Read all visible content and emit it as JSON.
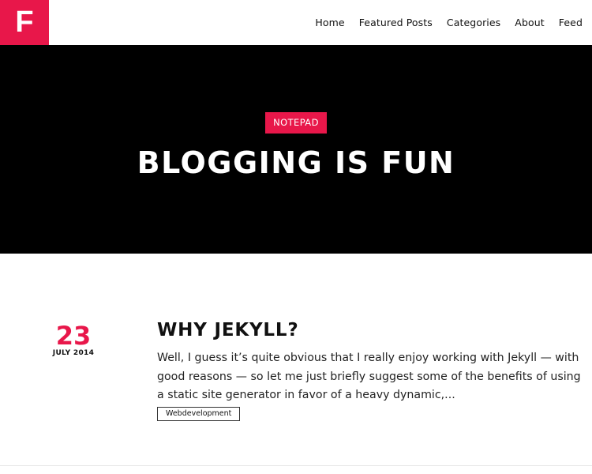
{
  "header": {
    "logo_letter": "F",
    "nav": [
      "Home",
      "Featured Posts",
      "Categories",
      "About",
      "Feed"
    ]
  },
  "hero": {
    "badge": "NOTEPAD",
    "title": "BLOGGING IS FUN"
  },
  "post": {
    "day": "23",
    "month_year": "JULY 2014",
    "title": "WHY JEKYLL?",
    "excerpt": "Well, I guess it’s quite obvious that I really enjoy working with Jekyll — with good reasons — so let me just briefly suggest some of the benefits of using a static site generator in favor of a heavy dynamic,...",
    "tag": "Webdevelopment"
  },
  "colors": {
    "accent": "#e8174a",
    "hero_bg": "#000000"
  }
}
